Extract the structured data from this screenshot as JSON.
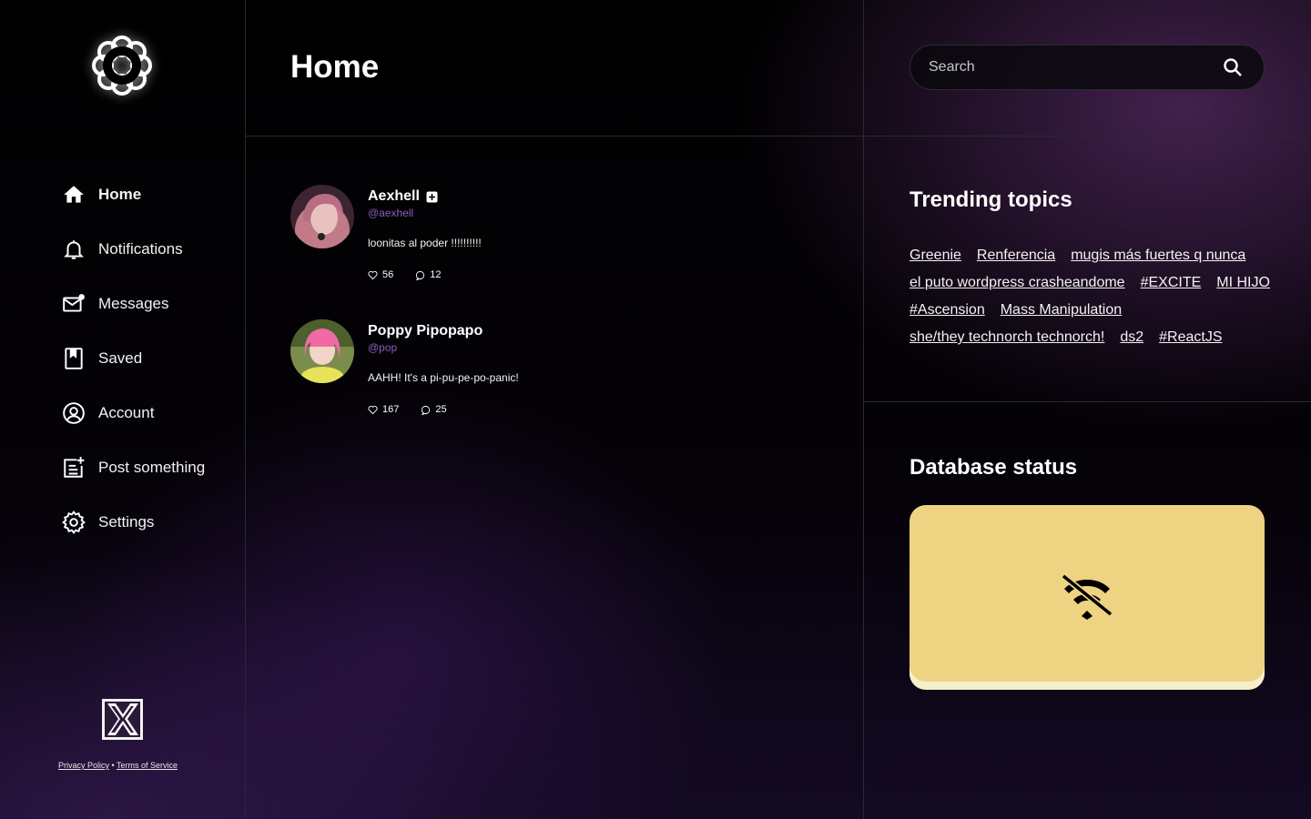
{
  "sidebar": {
    "logo_icon": "flower-ring-logo",
    "nav": [
      {
        "label": "Home",
        "icon": "home-icon",
        "active": true
      },
      {
        "label": "Notifications",
        "icon": "bell-icon"
      },
      {
        "label": "Messages",
        "icon": "mail-icon"
      },
      {
        "label": "Saved",
        "icon": "bookmark-icon"
      },
      {
        "label": "Account",
        "icon": "account-icon"
      },
      {
        "label": "Post something",
        "icon": "post-add-icon"
      },
      {
        "label": "Settings",
        "icon": "gear-icon"
      }
    ],
    "footer": {
      "privacy": "Privacy Policy",
      "separator": "•",
      "terms": "Terms of Service"
    }
  },
  "main": {
    "title": "Home",
    "posts": [
      {
        "name": "Aexhell",
        "handle": "@aexhell",
        "text": "loonitas al poder !!!!!!!!!!",
        "likes": "56",
        "comments": "12",
        "verified_icon": "badge-icon"
      },
      {
        "name": "Poppy Pipopapo",
        "handle": "@pop",
        "text": "AAHH! It's a pi-pu-pe-po-panic!",
        "likes": "167",
        "comments": "25"
      }
    ]
  },
  "right": {
    "search": {
      "placeholder": "Search",
      "value": ""
    },
    "trending": {
      "title": "Trending topics",
      "topics": [
        "Greenie",
        "Renferencia",
        "mugis más fuertes q nunca",
        "el puto wordpress crasheandome",
        "#EXCITE",
        "MI HIJO",
        "#Ascension",
        "Mass Manipulation",
        "she/they technorch technorch!",
        "ds2",
        "#ReactJS"
      ]
    },
    "database": {
      "title": "Database status",
      "status_icon": "wifi-off-icon",
      "card_color": "#edd382"
    }
  },
  "colors": {
    "accent_handle": "#8a5fbf",
    "divider": "#2a2a2e"
  }
}
